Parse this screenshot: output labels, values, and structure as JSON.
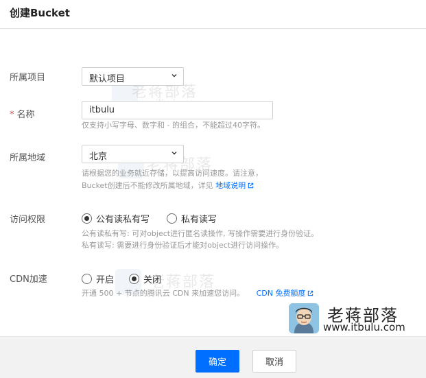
{
  "dialog": {
    "title": "创建Bucket"
  },
  "form": {
    "project": {
      "label": "所属项目",
      "value": "默认项目"
    },
    "name": {
      "required_mark": "*",
      "label": "名称",
      "value": "itbulu",
      "hint": "仅支持小写字母、数字和 - 的组合，不能超过40字符。"
    },
    "region": {
      "label": "所属地域",
      "value": "北京",
      "hint_line1": "请根据您的业务就近存储，以提高访问速度。请注意，",
      "hint_line2": "Bucket创建后不能修改所属地域，详见",
      "hint_link": "地域说明"
    },
    "access": {
      "label": "访问权限",
      "options": [
        "公有读私有写",
        "私有读写"
      ],
      "selected": "公有读私有写",
      "hint_line1": "公有读私有写: 可对object进行匿名读操作, 写操作需要进行身份验证。",
      "hint_line2": "私有读写: 需要进行身份验证后才能对object进行访问操作。"
    },
    "cdn": {
      "label": "CDN加速",
      "options": [
        "开启",
        "关闭"
      ],
      "selected": "关闭",
      "hint": "开通 500 + 节点的腾讯云 CDN 来加速您访问。",
      "hint_link": "CDN 免费额度"
    }
  },
  "footer": {
    "confirm_label": "确定",
    "cancel_label": "取消"
  },
  "watermark": {
    "name": "老蒋部落",
    "url": "www.itbulu.com"
  },
  "brand": {
    "name": "老蒋部落",
    "url": "www.itbulu.com"
  },
  "colors": {
    "primary": "#006eff",
    "required": "#e54545",
    "footer_bg": "#f2f2f2"
  },
  "icons": {
    "select_arrow": "chevron-down-icon",
    "external_link": "external-link-icon"
  }
}
